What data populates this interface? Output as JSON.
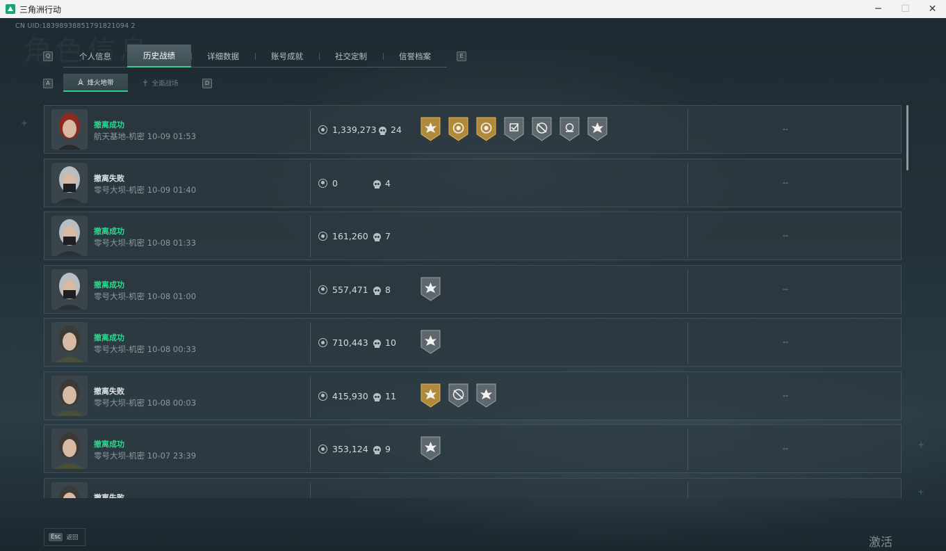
{
  "window": {
    "title": "三角洲行动",
    "minimize": "─",
    "maximize": "☐",
    "close": "✕"
  },
  "uid": "CN UID:18398938851791821094 2",
  "watermark": "角色信息",
  "nav": {
    "key_left": "Q",
    "key_right": "E",
    "tabs": [
      "个人信息",
      "历史战绩",
      "详细数据",
      "账号成就",
      "社交定制",
      "信誉档案"
    ],
    "active_index": 1
  },
  "subnav": {
    "key_left": "A",
    "key_right": "D",
    "tabs": [
      "烽火地带",
      "全面战场"
    ],
    "active_index": 0
  },
  "records": [
    {
      "status": "撤离成功",
      "ok": true,
      "map": "航天基地-机密 10-09 01:53",
      "value": "1,339,273",
      "kills": "24",
      "avatar": "red-hair",
      "medals": [
        "gold-sun",
        "gold-crest",
        "gold-coin",
        "silver-check",
        "silver-no-scope",
        "silver-skull",
        "silver-star"
      ],
      "extra": "--"
    },
    {
      "status": "撤离失败",
      "ok": false,
      "map": "零号大坝-机密 10-09 01:40",
      "value": "0",
      "kills": "4",
      "avatar": "masked",
      "medals": [],
      "extra": "--"
    },
    {
      "status": "撤离成功",
      "ok": true,
      "map": "零号大坝-机密 10-08 01:33",
      "value": "161,260",
      "kills": "7",
      "avatar": "masked",
      "medals": [],
      "extra": "--"
    },
    {
      "status": "撤离成功",
      "ok": true,
      "map": "零号大坝-机密 10-08 01:00",
      "value": "557,471",
      "kills": "8",
      "avatar": "masked",
      "medals": [
        "silver-star"
      ],
      "extra": "--"
    },
    {
      "status": "撤离成功",
      "ok": true,
      "map": "零号大坝-机密 10-08 00:33",
      "value": "710,443",
      "kills": "10",
      "avatar": "hooded",
      "medals": [
        "silver-star"
      ],
      "extra": "--"
    },
    {
      "status": "撤离失败",
      "ok": false,
      "map": "零号大坝-机密 10-08 00:03",
      "value": "415,930",
      "kills": "11",
      "avatar": "hooded",
      "medals": [
        "gold-sun",
        "silver-no-scope",
        "silver-star"
      ],
      "extra": "--"
    },
    {
      "status": "撤离成功",
      "ok": true,
      "map": "零号大坝-机密 10-07 23:39",
      "value": "353,124",
      "kills": "9",
      "avatar": "hooded",
      "medals": [
        "silver-star"
      ],
      "extra": "--"
    },
    {
      "status": "撤离失败",
      "ok": false,
      "map": "",
      "value": "",
      "kills": "",
      "avatar": "hooded",
      "medals": [],
      "extra": ""
    }
  ],
  "footer": {
    "esc_key": "Esc",
    "esc_label": "返回",
    "activate_windows": "激活 Windows"
  },
  "colors": {
    "accent": "#2fd08f",
    "success": "#2fd88f",
    "gold": "#b08a3a",
    "silver": "#5d676d"
  }
}
